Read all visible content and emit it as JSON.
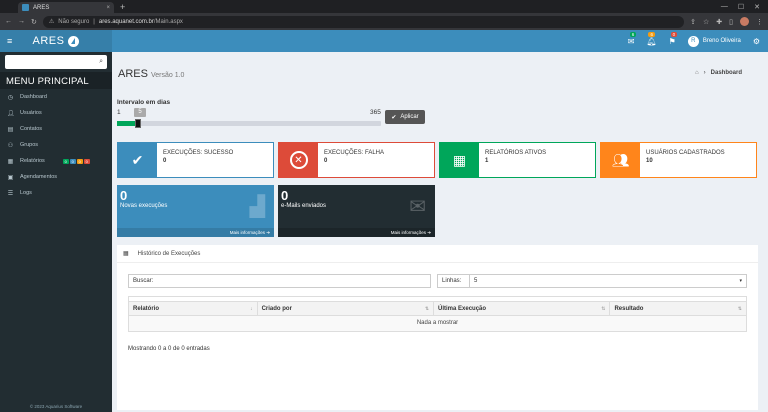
{
  "browser": {
    "tab_title": "ARES",
    "tab_close": "×",
    "new_tab": "+",
    "security_label": "Não seguro",
    "url_host": "ares.aquanet.com.br",
    "url_path": "/Main.aspx"
  },
  "app": {
    "logo": "ARES",
    "title": "ARES",
    "version": "Versão 1.0"
  },
  "navbar": {
    "badges": [
      {
        "icon": "envelope-icon",
        "count": "6",
        "color": "#00a65a"
      },
      {
        "icon": "bell-icon",
        "count": "6",
        "color": "#f39c12"
      },
      {
        "icon": "flag-icon",
        "count": "0",
        "color": "#dd4b39"
      }
    ],
    "user_initial": "R",
    "user_name": "Breno Oliveira"
  },
  "sidebar": {
    "header": "MENU PRINCIPAL",
    "items": [
      {
        "label": "Dashboard",
        "icon": "dashboard-icon"
      },
      {
        "label": "Usuários",
        "icon": "user-icon"
      },
      {
        "label": "Contatos",
        "icon": "contacts-icon"
      },
      {
        "label": "Grupos",
        "icon": "group-icon"
      },
      {
        "label": "Relatórios",
        "icon": "chart-icon"
      },
      {
        "label": "Agendamentos",
        "icon": "calendar-icon"
      },
      {
        "label": "Logs",
        "icon": "list-icon"
      }
    ],
    "report_pills": [
      {
        "v": "0",
        "color": "#00a65a"
      },
      {
        "v": "0",
        "color": "#3c8dbc"
      },
      {
        "v": "0",
        "color": "#f39c12"
      },
      {
        "v": "0",
        "color": "#dd4b39"
      }
    ],
    "footer": "© 2023 Aquarius Software"
  },
  "breadcrumb": {
    "current": "Dashboard"
  },
  "range": {
    "label": "Intervalo em dias",
    "min": "1",
    "max": "365",
    "value": "5",
    "fraction": 0.011,
    "apply_label": "Aplicar"
  },
  "info_boxes": [
    {
      "label": "EXECUÇÕES: SUCESSO",
      "value": "0",
      "color": "#3c8dbc",
      "icon": "check-icon"
    },
    {
      "label": "EXECUÇÕES: FALHA",
      "value": "0",
      "color": "#dd4b39",
      "icon": "times-icon"
    },
    {
      "label": "RELATÓRIOS ATIVOS",
      "value": "1",
      "color": "#00a65a",
      "icon": "grid-icon"
    },
    {
      "label": "USUÁRIOS CADASTRADOS",
      "value": "10",
      "color": "#ff851b",
      "icon": "users-icon"
    }
  ],
  "small_boxes": [
    {
      "value": "0",
      "label": "Novas execuções",
      "more": "Mais informações",
      "color": "#3c8dbc"
    },
    {
      "value": "0",
      "label": "e-Mails enviados",
      "more": "Mais informações",
      "color": "#222d32"
    }
  ],
  "history": {
    "title": "Histórico de Execuções",
    "search_label": "Buscar:",
    "search_value": "",
    "lines_label": "Linhas:",
    "lines_value": "5",
    "columns": [
      "Relatório",
      "Criado por",
      "Última Execução",
      "Resultado"
    ],
    "empty": "Nada a mostrar",
    "showing": "Mostrando 0 a 0 de 0 entradas"
  }
}
